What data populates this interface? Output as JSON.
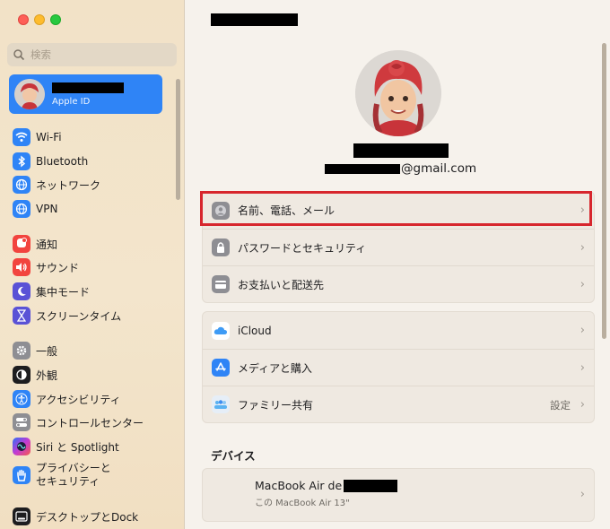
{
  "sidebar": {
    "search_placeholder": "検索",
    "account_subtitle": "Apple ID",
    "items": [
      {
        "label": "Wi-Fi",
        "icon": "wifi-icon",
        "color": "#2f84f6"
      },
      {
        "label": "Bluetooth",
        "icon": "bluetooth-icon",
        "color": "#2f84f6"
      },
      {
        "label": "ネットワーク",
        "icon": "globe-icon",
        "color": "#2f84f6"
      },
      {
        "label": "VPN",
        "icon": "vpn-globe-icon",
        "color": "#2f84f6"
      },
      {
        "label": "通知",
        "icon": "bell-icon",
        "color": "#f2443f"
      },
      {
        "label": "サウンド",
        "icon": "speaker-icon",
        "color": "#f2443f"
      },
      {
        "label": "集中モード",
        "icon": "moon-icon",
        "color": "#5a52d6"
      },
      {
        "label": "スクリーンタイム",
        "icon": "hourglass-icon",
        "color": "#5a52d6"
      },
      {
        "label": "一般",
        "icon": "gear-icon",
        "color": "#8e8e93"
      },
      {
        "label": "外観",
        "icon": "appearance-icon",
        "color": "#1d1d1f"
      },
      {
        "label": "アクセシビリティ",
        "icon": "accessibility-icon",
        "color": "#2f84f6"
      },
      {
        "label": "コントロールセンター",
        "icon": "toggles-icon",
        "color": "#8e8e93"
      },
      {
        "label": "Siri と Spotlight",
        "icon": "siri-icon",
        "color": "#6d3ec2"
      },
      {
        "label": "プライバシーと\nセキュリティ",
        "icon": "hand-icon",
        "color": "#2f84f6"
      },
      {
        "label": "デスクトップとDock",
        "icon": "dock-icon",
        "color": "#1d1d1f"
      }
    ]
  },
  "main": {
    "email_suffix": "@gmail.com",
    "rows_group1": [
      {
        "label": "名前、電話、メール",
        "icon": "person-icon"
      },
      {
        "label": "パスワードとセキュリティ",
        "icon": "lock-icon"
      },
      {
        "label": "お支払いと配送先",
        "icon": "creditcard-icon"
      }
    ],
    "rows_group2": [
      {
        "label": "iCloud",
        "icon": "cloud-icon",
        "value": ""
      },
      {
        "label": "メディアと購入",
        "icon": "appstore-icon",
        "value": ""
      },
      {
        "label": "ファミリー共有",
        "icon": "family-icon",
        "value": "設定"
      }
    ],
    "devices_heading": "デバイス",
    "device": {
      "title": "MacBook Air de",
      "subtitle": "この MacBook Air 13\""
    }
  }
}
